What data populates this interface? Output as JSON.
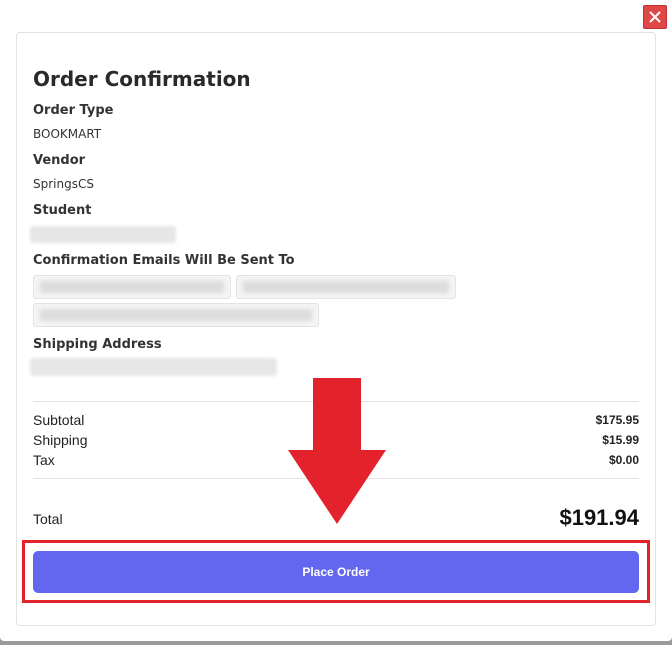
{
  "modal": {
    "close_icon": "close-x-icon",
    "title": "Order Confirmation",
    "order_type_label": "Order Type",
    "order_type_value": "BOOKMART",
    "vendor_label": "Vendor",
    "vendor_value": "SpringsCS",
    "student_label": "Student",
    "emails_label": "Confirmation Emails Will Be Sent To",
    "shipping_address_label": "Shipping Address"
  },
  "summary": {
    "subtotal_label": "Subtotal",
    "subtotal_value": "$175.95",
    "shipping_label": "Shipping",
    "shipping_value": "$15.99",
    "tax_label": "Tax",
    "tax_value": "$0.00",
    "total_label": "Total",
    "total_value": "$191.94"
  },
  "actions": {
    "place_order_label": "Place Order"
  },
  "annotation": {
    "arrow_color": "#e3222b",
    "highlight_color": "#e3222b"
  },
  "colors": {
    "accent": "#6366ee",
    "close_button": "#e04848"
  }
}
